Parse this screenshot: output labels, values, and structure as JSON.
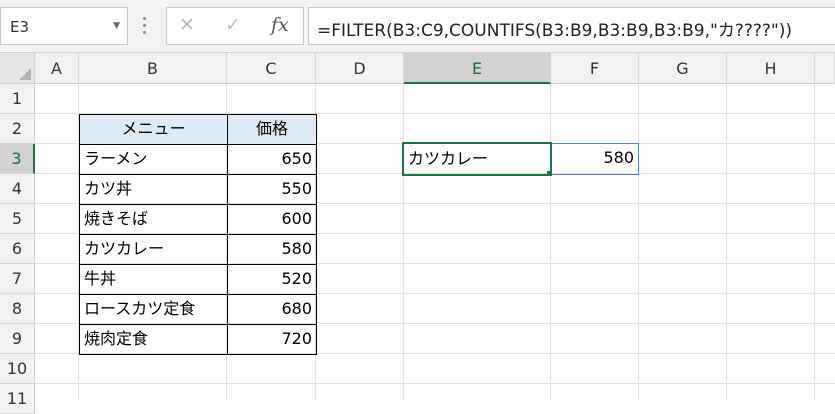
{
  "formula_bar": {
    "name_box": "E3",
    "cancel_glyph": "✕",
    "enter_glyph": "✓",
    "fx_label": "fx",
    "formula": "=FILTER(B3:C9,COUNTIFS(B3:B9,B3:B9,B3:B9,\"カ????\"))"
  },
  "columns": [
    "A",
    "B",
    "C",
    "D",
    "E",
    "F",
    "G",
    "H"
  ],
  "rows": [
    "1",
    "2",
    "3",
    "4",
    "5",
    "6",
    "7",
    "8",
    "9",
    "10",
    "11"
  ],
  "selected": {
    "column": "E",
    "row": "3"
  },
  "table": {
    "headers": [
      "メニュー",
      "価格"
    ],
    "rows": [
      [
        "ラーメン",
        "650"
      ],
      [
        "カツ丼",
        "550"
      ],
      [
        "焼きそば",
        "600"
      ],
      [
        "カツカレー",
        "580"
      ],
      [
        "牛丼",
        "520"
      ],
      [
        "ロースカツ定食",
        "680"
      ],
      [
        "焼肉定食",
        "720"
      ]
    ]
  },
  "result": {
    "name": "カツカレー",
    "price": "580"
  },
  "colors": {
    "accent": "#217346",
    "header_fill": "#ddebf7",
    "spill_border": "#5b7fcf"
  }
}
